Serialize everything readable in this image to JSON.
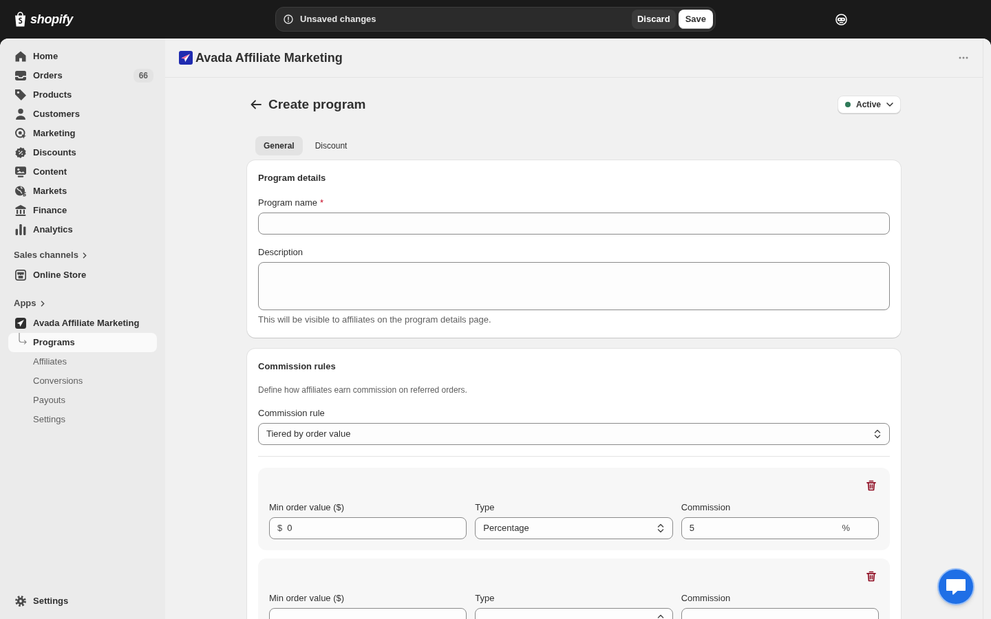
{
  "top_bar": {
    "logo_text": "shopify",
    "unsaved_bar": {
      "message": "Unsaved changes",
      "buttons": [
        {
          "label": "Discard",
          "kind": "secondary"
        },
        {
          "label": "Save",
          "kind": "primary"
        }
      ]
    }
  },
  "sidebar": {
    "items": [
      {
        "label": "Home",
        "selected": false
      },
      {
        "label": "Orders",
        "badge": "66",
        "selected": false
      },
      {
        "label": "Products",
        "selected": false
      },
      {
        "label": "Customers",
        "selected": false
      },
      {
        "label": "Marketing",
        "selected": false
      },
      {
        "label": "Discounts",
        "selected": false
      },
      {
        "label": "Content",
        "selected": false
      },
      {
        "label": "Markets",
        "selected": false
      },
      {
        "label": "Finance",
        "selected": false
      },
      {
        "label": "Analytics",
        "selected": false
      }
    ],
    "sections": [
      {
        "title": "Sales channels",
        "items": [
          {
            "label": "Online Store",
            "selected": false
          }
        ]
      },
      {
        "title": "Apps",
        "items": [
          {
            "label": "Avada Affiliate Marketing",
            "selected": false,
            "children": [
              {
                "label": "Programs",
                "selected": true
              },
              {
                "label": "Affiliates",
                "selected": false
              },
              {
                "label": "Conversions",
                "selected": false
              },
              {
                "label": "Payouts",
                "selected": false
              },
              {
                "label": "Settings",
                "selected": false
              }
            ]
          }
        ]
      }
    ],
    "footer_items": [
      {
        "label": "Settings",
        "selected": false
      }
    ]
  },
  "app_header": {
    "title": "Avada Affiliate Marketing"
  },
  "page": {
    "title": "Create program",
    "status": {
      "label": "Active"
    },
    "tabs": [
      {
        "label": "General",
        "selected": true
      },
      {
        "label": "Discount",
        "selected": false
      }
    ],
    "program_details": {
      "title": "Program details",
      "fields": [
        {
          "kind": "text",
          "label": "Program name",
          "required_mark": "*"
        },
        {
          "kind": "textarea",
          "label": "Description",
          "help": "This will be visible to affiliates on the program details page."
        }
      ]
    },
    "commission_rules": {
      "title": "Commission rules",
      "description": "Define how affiliates earn commission on referred orders.",
      "rule_select": {
        "label": "Commission rule",
        "value": "Tiered by order value"
      },
      "tiers": [
        {
          "fields": [
            {
              "kind": "input",
              "label": "Min order value ($)",
              "prefix": "$",
              "value": "0"
            },
            {
              "kind": "select",
              "label": "Type",
              "value": "Percentage"
            },
            {
              "kind": "input",
              "label": "Commission",
              "value": "5",
              "suffix": "%"
            }
          ]
        },
        {
          "fields": [
            {
              "kind": "input",
              "label": "Min order value ($)"
            },
            {
              "kind": "select",
              "label": "Type"
            },
            {
              "kind": "input",
              "label": "Commission"
            }
          ]
        }
      ]
    }
  }
}
